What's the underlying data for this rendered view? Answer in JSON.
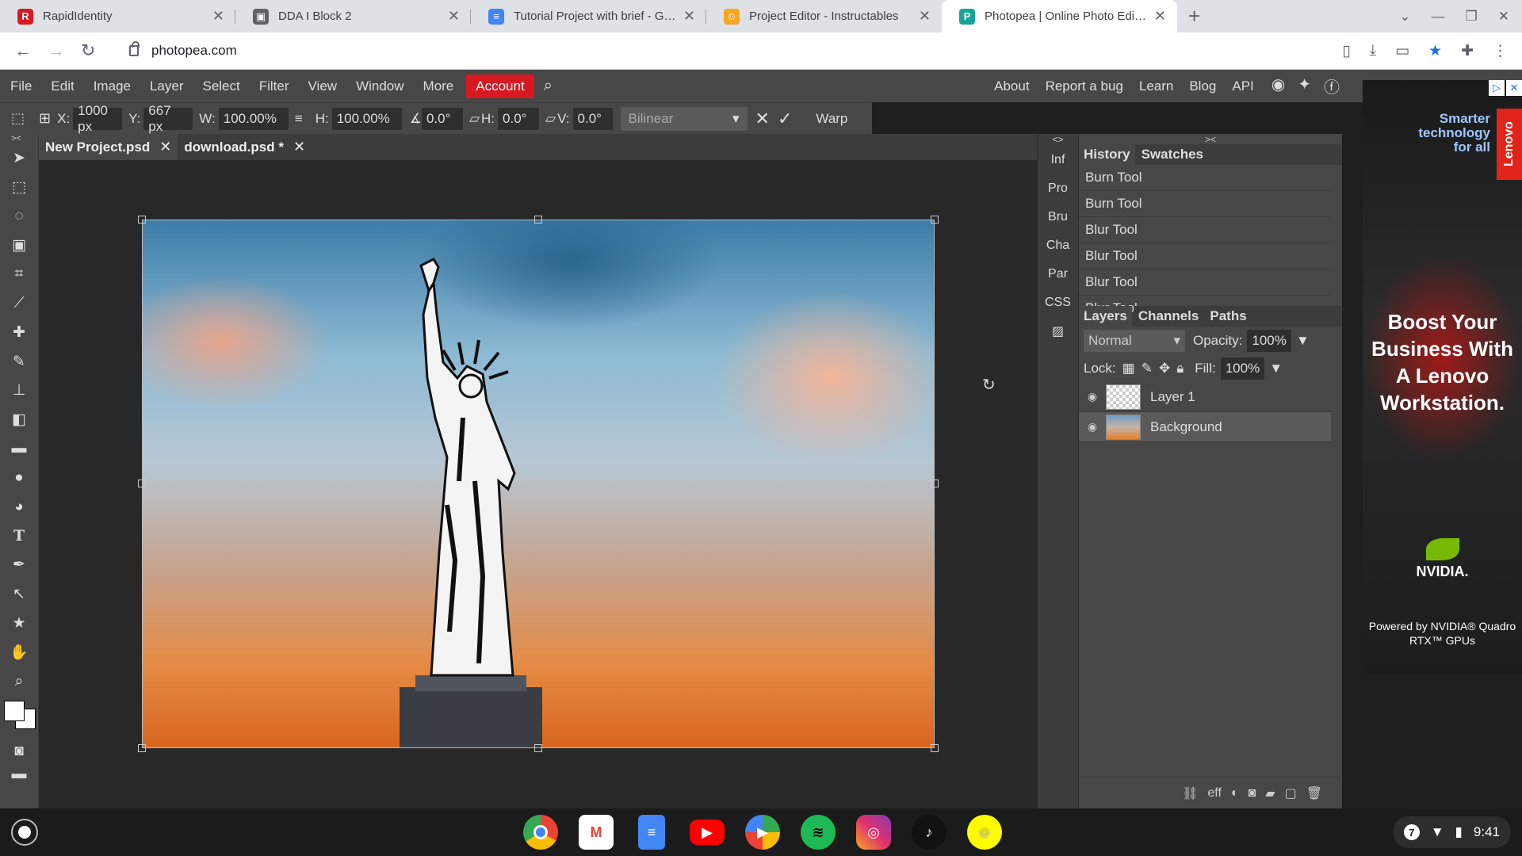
{
  "browser": {
    "tabs": [
      {
        "title": "RapidIdentity",
        "icon": "rapididentity-icon",
        "color": "#d71a21",
        "glyph": "R"
      },
      {
        "title": "DDA I Block 2",
        "icon": "classroom-icon",
        "color": "#5f6368",
        "glyph": "▣"
      },
      {
        "title": "Tutorial Project with brief - Googl",
        "icon": "docs-icon",
        "color": "#4285f4",
        "glyph": "≡"
      },
      {
        "title": "Project Editor - Instructables",
        "icon": "instructables-icon",
        "color": "#f5a623",
        "glyph": "☺"
      },
      {
        "title": "Photopea | Online Photo Editor",
        "icon": "photopea-icon",
        "color": "#18a497",
        "glyph": "P"
      }
    ],
    "url": "photopea.com"
  },
  "menu": {
    "items": [
      "File",
      "Edit",
      "Image",
      "Layer",
      "Select",
      "Filter",
      "View",
      "Window",
      "More"
    ],
    "account": "Account",
    "right": [
      "About",
      "Report a bug",
      "Learn",
      "Blog",
      "API"
    ]
  },
  "options": {
    "x_label": "X:",
    "x": "1000 px",
    "y_label": "Y:",
    "y": "667 px",
    "w_label": "W:",
    "w": "100.00%",
    "h_label": "H:",
    "h": "100.00%",
    "angle": "0.0°",
    "skew_h_label": "H:",
    "skew_h": "0.0°",
    "skew_v_label": "V:",
    "skew_v": "0.0°",
    "interp": "Bilinear",
    "warp": "Warp"
  },
  "documents": [
    {
      "name": "New Project.psd"
    },
    {
      "name": "download.psd *"
    }
  ],
  "collapsed_panels": [
    "Inf",
    "Pro",
    "Bru",
    "Cha",
    "Par",
    "CSS"
  ],
  "history": {
    "tabs": [
      "History",
      "Swatches"
    ],
    "items": [
      "Burn Tool",
      "Burn Tool",
      "Blur Tool",
      "Blur Tool",
      "Blur Tool",
      "Blur Tool"
    ]
  },
  "layers": {
    "tabs": [
      "Layers",
      "Channels",
      "Paths"
    ],
    "blend": "Normal",
    "opacity_label": "Opacity:",
    "opacity": "100%",
    "lock_label": "Lock:",
    "fill_label": "Fill:",
    "fill": "100%",
    "items": [
      {
        "name": "Layer 1",
        "selected": false
      },
      {
        "name": "Background",
        "selected": true
      }
    ],
    "footer": "eff"
  },
  "ad": {
    "tagline": "Smarter technology for all",
    "brand": "Lenovo",
    "headline": "Boost Your Business With A Lenovo Workstation.",
    "nvidia": "NVIDIA.",
    "powered": "Powered by NVIDIA® Quadro RTX™ GPUs"
  },
  "shelf": {
    "apps": [
      {
        "name": "chrome-icon",
        "color": "#4285f4",
        "glyph": "●"
      },
      {
        "name": "gmail-icon",
        "color": "#ea4335",
        "glyph": "M"
      },
      {
        "name": "docs-icon",
        "color": "#4285f4",
        "glyph": "≡"
      },
      {
        "name": "youtube-icon",
        "color": "#ff0000",
        "glyph": "▶"
      },
      {
        "name": "play-store-icon",
        "color": "#34a853",
        "glyph": "▶"
      },
      {
        "name": "spotify-icon",
        "color": "#1db954",
        "glyph": "≋"
      },
      {
        "name": "instagram-icon",
        "color": "#c13584",
        "glyph": "◎"
      },
      {
        "name": "tiktok-icon",
        "color": "#111111",
        "glyph": "♪"
      },
      {
        "name": "snapchat-icon",
        "color": "#fffc00",
        "glyph": "☺"
      }
    ],
    "notif_count": "7",
    "time": "9:41"
  }
}
